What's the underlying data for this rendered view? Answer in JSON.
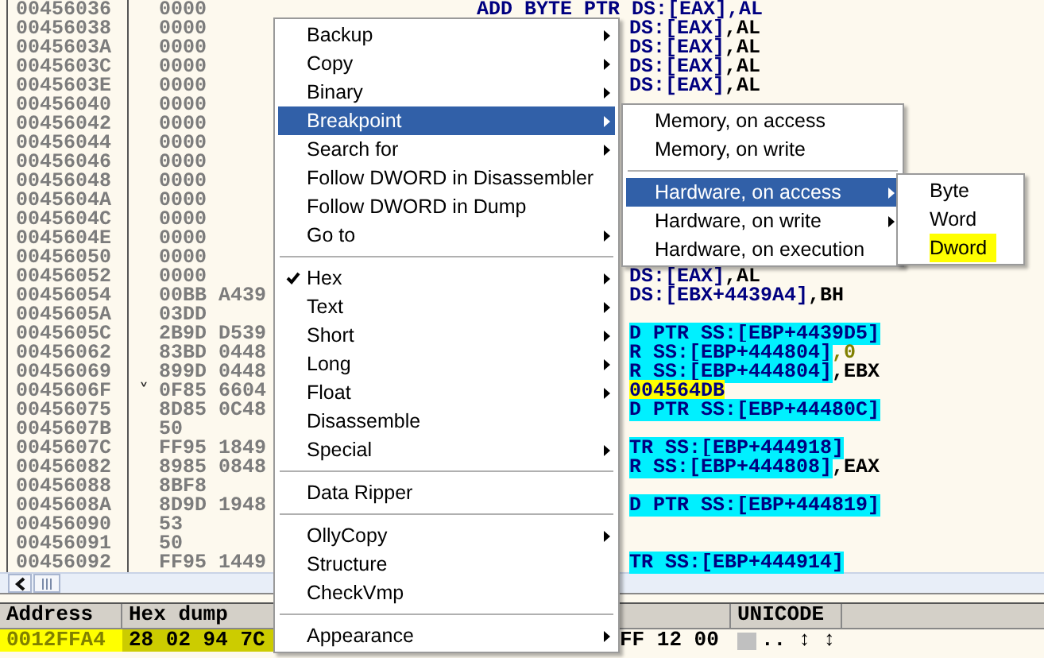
{
  "disassembly": {
    "rows": [
      {
        "address": "00456036",
        "hex": "0000",
        "clipped": false,
        "disasm": [
          {
            "text": "ADD BYTE PTR DS:[EAX],AL",
            "kind": "mem"
          }
        ]
      },
      {
        "address": "00456038",
        "hex": "0000",
        "clipped": true,
        "disasm": [
          {
            "text": "DS:[EAX]",
            "kind": "mem"
          },
          {
            "text": ",AL",
            "kind": "reg"
          }
        ]
      },
      {
        "address": "0045603A",
        "hex": "0000",
        "clipped": true,
        "disasm": [
          {
            "text": "DS:[EAX]",
            "kind": "mem"
          },
          {
            "text": ",AL",
            "kind": "reg"
          }
        ]
      },
      {
        "address": "0045603C",
        "hex": "0000",
        "clipped": true,
        "disasm": [
          {
            "text": "DS:[EAX]",
            "kind": "mem"
          },
          {
            "text": ",AL",
            "kind": "reg"
          }
        ]
      },
      {
        "address": "0045603E",
        "hex": "0000",
        "clipped": true,
        "disasm": [
          {
            "text": "DS:[EAX]",
            "kind": "mem"
          },
          {
            "text": ",AL",
            "kind": "reg"
          }
        ]
      },
      {
        "address": "00456040",
        "hex": "0000"
      },
      {
        "address": "00456042",
        "hex": "0000"
      },
      {
        "address": "00456044",
        "hex": "0000"
      },
      {
        "address": "00456046",
        "hex": "0000"
      },
      {
        "address": "00456048",
        "hex": "0000"
      },
      {
        "address": "0045604A",
        "hex": "0000"
      },
      {
        "address": "0045604C",
        "hex": "0000"
      },
      {
        "address": "0045604E",
        "hex": "0000"
      },
      {
        "address": "00456050",
        "hex": "0000"
      },
      {
        "address": "00456052",
        "hex": "0000",
        "clipped": true,
        "disasm": [
          {
            "text": "DS:[EAX]",
            "kind": "mem"
          },
          {
            "text": ",AL",
            "kind": "reg"
          }
        ]
      },
      {
        "address": "00456054",
        "hex": "00BB A439",
        "clipped": true,
        "disasm": [
          {
            "text": "DS:[EBX+4439A4]",
            "kind": "mem"
          },
          {
            "text": ",BH",
            "kind": "reg"
          }
        ]
      },
      {
        "address": "0045605A",
        "hex": "03DD"
      },
      {
        "address": "0045605C",
        "hex": "2B9D D539",
        "clipped": true,
        "disasm": [
          {
            "text": "D PTR SS:[EBP+4439D5]",
            "kind": "hl"
          }
        ]
      },
      {
        "address": "00456062",
        "hex": "83BD 0448",
        "clipped": true,
        "disasm": [
          {
            "text": "R SS:[EBP+444804]",
            "kind": "hl"
          },
          {
            "text": ",0",
            "kind": "num"
          }
        ]
      },
      {
        "address": "00456069",
        "hex": "899D 0448",
        "clipped": true,
        "disasm": [
          {
            "text": "R SS:[EBP+444804]",
            "kind": "hl"
          },
          {
            "text": ",EBX",
            "kind": "reg"
          }
        ]
      },
      {
        "address": "0045606F",
        "marker": "˅",
        "hex": "0F85 6604",
        "clipped": true,
        "disasm": [
          {
            "text": "004564DB",
            "kind": "target"
          }
        ]
      },
      {
        "address": "00456075",
        "hex": "8D85 0C48",
        "clipped": true,
        "disasm": [
          {
            "text": "D PTR SS:[EBP+44480C]",
            "kind": "hl"
          }
        ]
      },
      {
        "address": "0045607B",
        "hex": "50"
      },
      {
        "address": "0045607C",
        "hex": "FF95 1849",
        "clipped": true,
        "disasm": [
          {
            "text": "TR SS:[EBP+444918]",
            "kind": "hl"
          }
        ]
      },
      {
        "address": "00456082",
        "hex": "8985 0848",
        "clipped": true,
        "disasm": [
          {
            "text": "R SS:[EBP+444808]",
            "kind": "hl"
          },
          {
            "text": ",EAX",
            "kind": "reg"
          }
        ]
      },
      {
        "address": "00456088",
        "hex": "8BF8"
      },
      {
        "address": "0045608A",
        "hex": "8D9D 1948",
        "clipped": true,
        "disasm": [
          {
            "text": "D PTR SS:[EBP+444819]",
            "kind": "hl"
          }
        ]
      },
      {
        "address": "00456090",
        "hex": "53"
      },
      {
        "address": "00456091",
        "hex": "50"
      },
      {
        "address": "00456092",
        "hex": "FF95 1449",
        "clipped": true,
        "disasm": [
          {
            "text": "TR SS:[EBP+444914]",
            "kind": "hl"
          }
        ]
      }
    ]
  },
  "dump": {
    "columns": [
      "Address",
      "Hex dump",
      "UNICODE"
    ],
    "rows": [
      {
        "address": "0012FFA4",
        "hex_1": "28 02 94 7C",
        "hex_2": "FF 12 00",
        "unicode": ".. ↕ ↕"
      }
    ]
  },
  "context_menu": {
    "items": [
      {
        "kind": "item",
        "label": "Backup",
        "submenu": true,
        "checked": false,
        "selected": false
      },
      {
        "kind": "item",
        "label": "Copy",
        "submenu": true,
        "checked": false,
        "selected": false
      },
      {
        "kind": "item",
        "label": "Binary",
        "submenu": true,
        "checked": false,
        "selected": false
      },
      {
        "kind": "item",
        "label": "Breakpoint",
        "submenu": true,
        "checked": false,
        "selected": true
      },
      {
        "kind": "item",
        "label": "Search for",
        "submenu": true,
        "checked": false,
        "selected": false
      },
      {
        "kind": "item",
        "label": "Follow DWORD in Disassembler",
        "submenu": false,
        "checked": false,
        "selected": false
      },
      {
        "kind": "item",
        "label": "Follow DWORD in Dump",
        "submenu": false,
        "checked": false,
        "selected": false
      },
      {
        "kind": "item",
        "label": "Go to",
        "submenu": true,
        "checked": false,
        "selected": false
      },
      {
        "kind": "separator"
      },
      {
        "kind": "item",
        "label": "Hex",
        "submenu": true,
        "checked": true,
        "selected": false
      },
      {
        "kind": "item",
        "label": "Text",
        "submenu": true,
        "checked": false,
        "selected": false
      },
      {
        "kind": "item",
        "label": "Short",
        "submenu": true,
        "checked": false,
        "selected": false
      },
      {
        "kind": "item",
        "label": "Long",
        "submenu": true,
        "checked": false,
        "selected": false
      },
      {
        "kind": "item",
        "label": "Float",
        "submenu": true,
        "checked": false,
        "selected": false
      },
      {
        "kind": "item",
        "label": "Disassemble",
        "submenu": false,
        "checked": false,
        "selected": false
      },
      {
        "kind": "item",
        "label": "Special",
        "submenu": true,
        "checked": false,
        "selected": false
      },
      {
        "kind": "separator"
      },
      {
        "kind": "item",
        "label": "Data Ripper",
        "submenu": false,
        "checked": false,
        "selected": false
      },
      {
        "kind": "separator"
      },
      {
        "kind": "item",
        "label": "OllyCopy",
        "submenu": true,
        "checked": false,
        "selected": false
      },
      {
        "kind": "item",
        "label": "Structure",
        "submenu": false,
        "checked": false,
        "selected": false
      },
      {
        "kind": "item",
        "label": "CheckVmp",
        "submenu": false,
        "checked": false,
        "selected": false
      },
      {
        "kind": "separator"
      },
      {
        "kind": "item",
        "label": "Appearance",
        "submenu": true,
        "checked": false,
        "selected": false
      }
    ]
  },
  "breakpoint_menu": {
    "items": [
      {
        "kind": "item",
        "label": "Memory, on access",
        "submenu": false,
        "selected": false
      },
      {
        "kind": "item",
        "label": "Memory, on write",
        "submenu": false,
        "selected": false
      },
      {
        "kind": "separator"
      },
      {
        "kind": "item",
        "label": "Hardware, on access",
        "submenu": true,
        "selected": true
      },
      {
        "kind": "item",
        "label": "Hardware, on write",
        "submenu": true,
        "selected": false
      },
      {
        "kind": "item",
        "label": "Hardware, on execution",
        "submenu": false,
        "selected": false
      }
    ]
  },
  "hardware_menu": {
    "items": [
      {
        "label": "Byte",
        "marked": false,
        "selected": false
      },
      {
        "label": "Word",
        "marked": false,
        "selected": false
      },
      {
        "label": "Dword",
        "marked": true,
        "selected": false
      }
    ]
  }
}
